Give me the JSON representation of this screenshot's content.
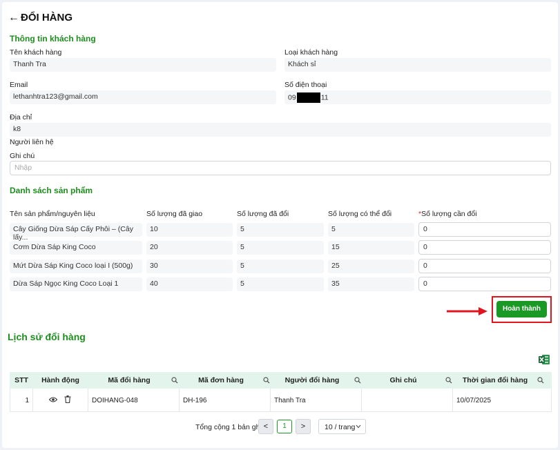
{
  "page": {
    "back_arrow": "←",
    "title": "ĐỔI HÀNG"
  },
  "customer": {
    "section_title": "Thông tin khách hàng",
    "name_label": "Tên khách hàng",
    "name_value": "Thanh Tra",
    "type_label": "Loại khách hàng",
    "type_value": "Khách sỉ",
    "email_label": "Email",
    "email_value": "lethanhtra123@gmail.com",
    "phone_label": "Số điện thoại",
    "phone_prefix": "09",
    "phone_suffix": "11",
    "address_label": "Địa chỉ",
    "address_value": "k8",
    "contact_label": "Người liên hệ",
    "note_label": "Ghi chú",
    "note_placeholder": "Nhập"
  },
  "products": {
    "section_title": "Danh sách sản phẩm",
    "headers": {
      "name": "Tên sản phẩm/nguyên liệu",
      "delivered": "Số lượng đã giao",
      "exchanged": "Số lượng đã đổi",
      "exchangeable": "Số lượng có thể đổi",
      "required_mark": "*",
      "to_exchange": "Số lượng cần đổi"
    },
    "rows": [
      {
        "name": "Cây Giống Dừa Sáp Cấy Phôi – (Cây lấy...",
        "delivered": "10",
        "exchanged": "5",
        "exchangeable": "5",
        "to_exchange": "0"
      },
      {
        "name": "Cơm Dừa Sáp King Coco",
        "delivered": "20",
        "exchanged": "5",
        "exchangeable": "15",
        "to_exchange": "0"
      },
      {
        "name": "Mứt Dừa Sáp King Coco loại I (500g)",
        "delivered": "30",
        "exchanged": "5",
        "exchangeable": "25",
        "to_exchange": "0"
      },
      {
        "name": "Dừa Sáp Ngọc King Coco Loại 1",
        "delivered": "40",
        "exchanged": "5",
        "exchangeable": "35",
        "to_exchange": "0"
      }
    ],
    "complete_button": "Hoàn thành"
  },
  "history": {
    "section_title": "Lịch sử đổi hàng",
    "columns": [
      "STT",
      "Hành động",
      "Mã đổi hàng",
      "Mã đơn hàng",
      "Người đổi hàng",
      "Ghi chú",
      "Thời gian đổi hàng"
    ],
    "rows": [
      {
        "stt": "1",
        "exchange_code": "DOIHANG-048",
        "order_code": "DH-196",
        "person": "Thanh Tra",
        "note": "",
        "time": "10/07/2025"
      }
    ]
  },
  "pagination": {
    "total_text": "Tổng cộng 1 bản ghi",
    "prev": "<",
    "current_page": "1",
    "next": ">",
    "page_size": "10 / trang"
  },
  "colors": {
    "accent_green": "#1a9a24",
    "section_green": "#1e8e1e",
    "highlight_red": "#e0141c",
    "table_header_bg": "#e3f4ec"
  },
  "icons": [
    "back-arrow-icon",
    "eye-icon",
    "trash-icon",
    "search-icon",
    "excel-export-icon",
    "chevron-down-icon"
  ]
}
